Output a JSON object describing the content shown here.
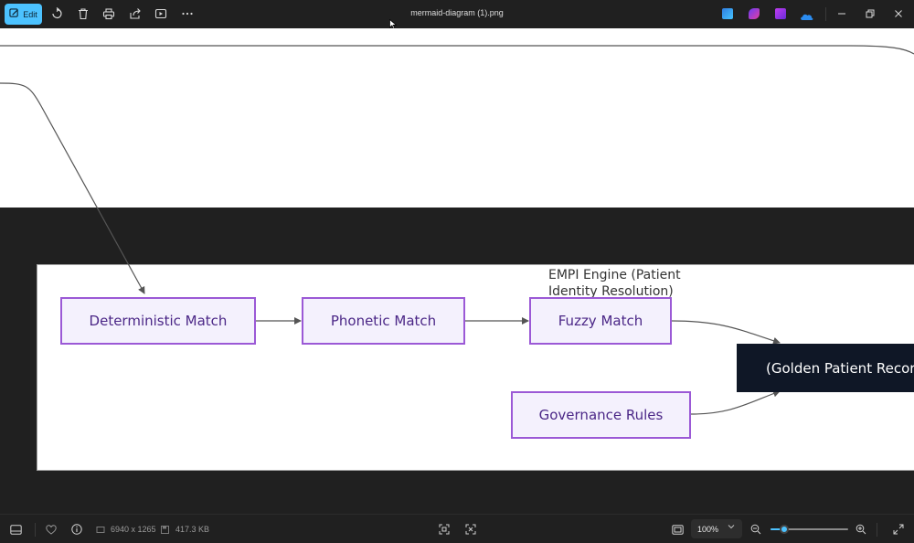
{
  "toolbar": {
    "edit_label": "Edit",
    "file_name": "mermaid-diagram (1).png"
  },
  "icons": {
    "edit": "edit-icon",
    "rotate": "rotate-icon",
    "delete": "trash-icon",
    "print": "print-icon",
    "share": "share-icon",
    "slideshow": "slideshow-icon",
    "more": "more-icon",
    "designer": "designer-app-icon",
    "clipchamp": "clipchamp-app-icon",
    "photos_legacy": "photos-app-icon",
    "onedrive": "onedrive-icon",
    "minimize": "minimize-icon",
    "restore": "restore-icon",
    "close": "close-icon"
  },
  "diagram": {
    "cluster_title": "EMPI Engine (Patient Identity Resolution)",
    "nodes": {
      "deterministic": "Deterministic Match",
      "phonetic": "Phonetic Match",
      "fuzzy": "Fuzzy Match",
      "governance": "Governance Rules",
      "golden": "(Golden Patient Record)"
    }
  },
  "statusbar": {
    "dimensions": "6940 x 1265",
    "file_size": "417.3 KB",
    "zoom": "100%",
    "zoom_level": 0.18
  },
  "colors": {
    "accent": "#4cc2ff",
    "node_fill": "#f4f1fd",
    "node_border": "#9b59d6",
    "node_text": "#4b2787",
    "dark_node": "#0f1726"
  }
}
